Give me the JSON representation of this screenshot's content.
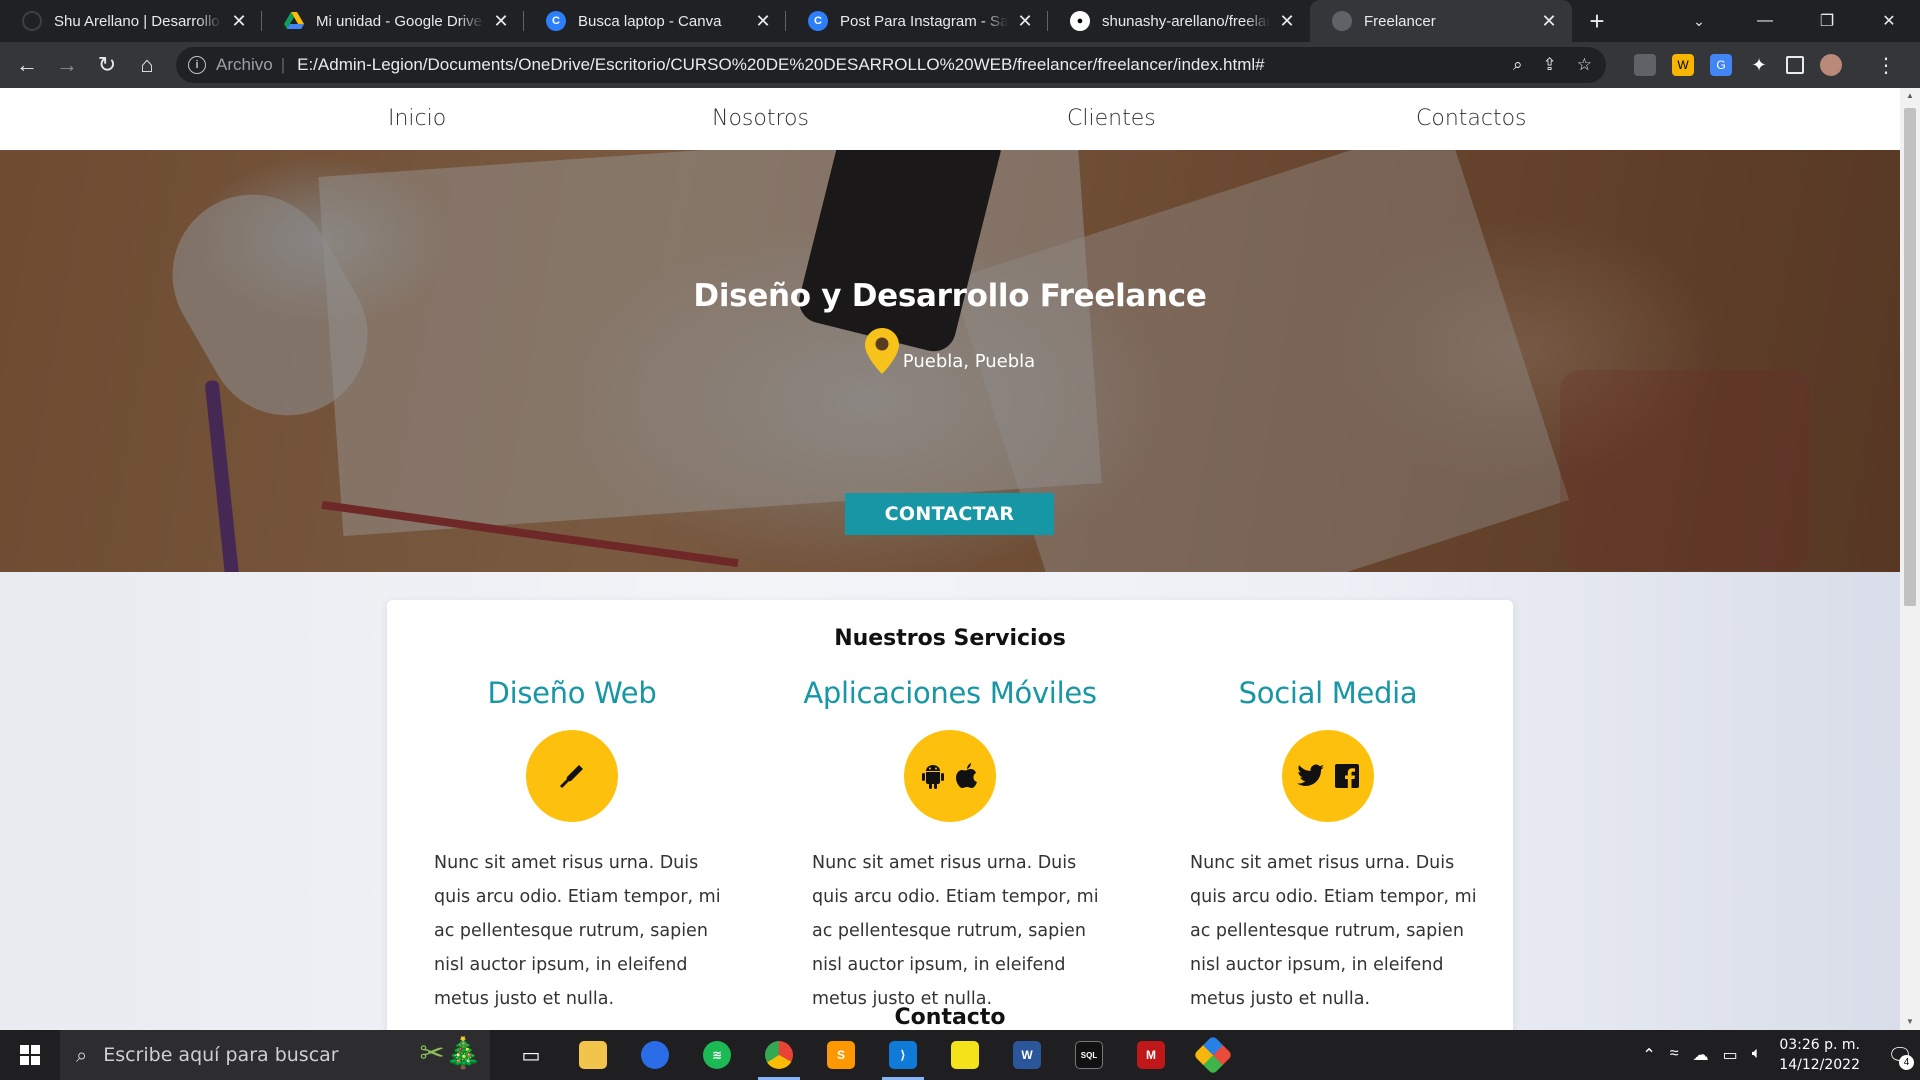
{
  "browser": {
    "tabs": [
      {
        "title": "Shu Arellano | Desarrollo W",
        "favicon": "circle-icon",
        "color": "#1a73e8"
      },
      {
        "title": "Mi unidad - Google Drive",
        "favicon": "google-drive-icon",
        "color": "#fbbc04"
      },
      {
        "title": "Busca laptop - Canva",
        "favicon": "canva-icon",
        "color": "#00c4cc"
      },
      {
        "title": "Post Para Instagram - Sale V",
        "favicon": "canva-icon",
        "color": "#00c4cc"
      },
      {
        "title": "shunashy-arellano/freelanc",
        "favicon": "github-icon",
        "color": "#ffffff"
      },
      {
        "title": "Freelancer",
        "favicon": "globe-icon",
        "color": "#9aa0a6"
      }
    ],
    "active_tab": 5,
    "address": {
      "scheme_label": "Archivo",
      "url": "E:/Admin-Legion/Documents/OneDrive/Escritorio/CURSO%20DE%20DESARROLLO%20WEB/freelancer/freelancer/index.html#"
    }
  },
  "site": {
    "nav": [
      "Inicio",
      "Nosotros",
      "Clientes",
      "Contactos"
    ],
    "hero": {
      "title": "Diseño y Desarrollo Freelance",
      "location": "Puebla, Puebla",
      "button": "CONTACTAR"
    },
    "services": {
      "title": "Nuestros Servicios",
      "items": [
        {
          "name": "Diseño Web",
          "icons": [
            "pen-icon"
          ],
          "text": "Nunc sit amet risus urna. Duis quis arcu odio. Etiam tempor, mi ac pellentesque rutrum, sapien nisl auctor ipsum, in eleifend metus justo et nulla."
        },
        {
          "name": "Aplicaciones Móviles",
          "icons": [
            "android-icon",
            "apple-icon"
          ],
          "text": "Nunc sit amet risus urna. Duis quis arcu odio. Etiam tempor, mi ac pellentesque rutrum, sapien nisl auctor ipsum, in eleifend metus justo et nulla."
        },
        {
          "name": "Social Media",
          "icons": [
            "twitter-icon",
            "facebook-icon"
          ],
          "text": "Nunc sit amet risus urna. Duis quis arcu odio. Etiam tempor, mi ac pellentesque rutrum, sapien nisl auctor ipsum, in eleifend metus justo et nulla."
        }
      ]
    },
    "contact_title": "Contacto",
    "colors": {
      "accent": "#1797a6",
      "icon_bg": "#fdc00c",
      "pin": "#f7c21a"
    }
  },
  "taskbar": {
    "search_placeholder": "Escribe aquí para buscar",
    "time": "03:26 p. m.",
    "date": "14/12/2022",
    "notifications": "4"
  }
}
